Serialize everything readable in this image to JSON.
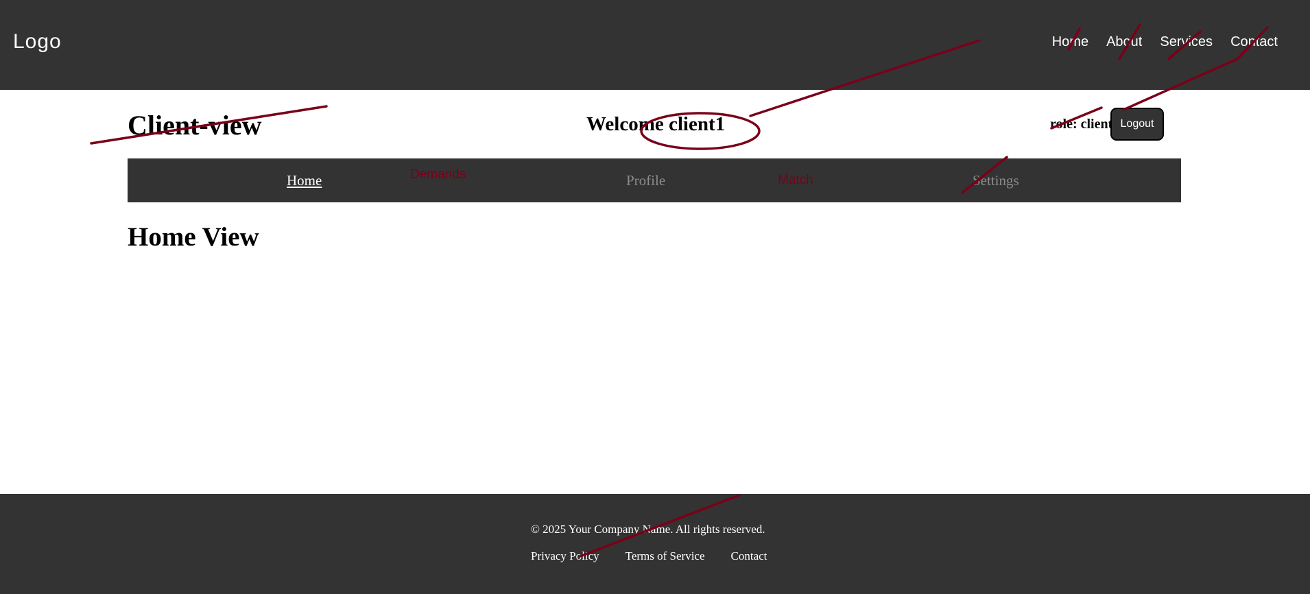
{
  "topbar": {
    "logo": "Logo",
    "nav": [
      "Home",
      "About",
      "Services",
      "Contact"
    ]
  },
  "header": {
    "title": "Client-view",
    "welcome": "Welcome client1",
    "role": "role: client",
    "logout_label": "Logout"
  },
  "subnav": {
    "home": "Home",
    "demands": "Demands",
    "profile": "Profile",
    "match": "Match",
    "settings": "Settings"
  },
  "main": {
    "section_title": "Home View"
  },
  "footer": {
    "copyright": "© 2025 Your Company Name. All rights reserved.",
    "links": [
      "Privacy Policy",
      "Terms of Service",
      "Contact"
    ]
  },
  "colors": {
    "bar": "#333333",
    "annotation": "#7a0019",
    "muted_link": "#8c8c8c"
  }
}
